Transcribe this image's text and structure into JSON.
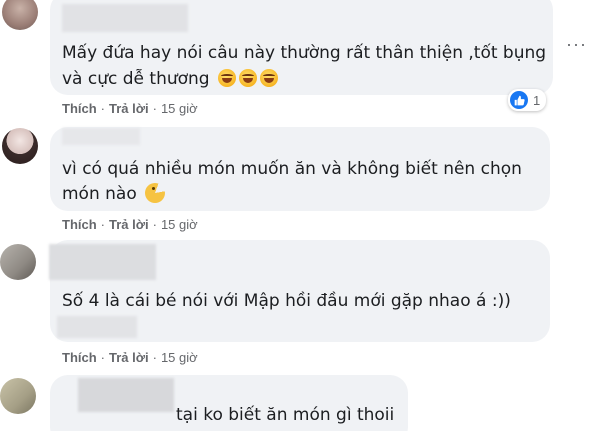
{
  "actions": {
    "like_label": "Thích",
    "reply_label": "Trả lời",
    "separator": "·"
  },
  "comments": [
    {
      "text_lines": [
        "Mấy đứa hay nói câu này thường rất thân thiện ,tốt bụng",
        "và cực dễ thương"
      ],
      "emoji": [
        "laughing-tears-icon",
        "laughing-tears-icon",
        "laughing-tears-icon"
      ],
      "time": "15 giờ",
      "reactions": {
        "icon": "like-icon",
        "count": "1"
      },
      "more": "···"
    },
    {
      "text_lines": [
        "vì có quá nhiều món muốn ăn và không biết nên chọn",
        "món nào"
      ],
      "emoji": [
        "pacman-icon"
      ],
      "time": "15 giờ"
    },
    {
      "text_lines": [
        "Số 4 là cái bé nói với Mập hồi đầu mới gặp nhao á :))"
      ],
      "time": "15 giờ"
    },
    {
      "text_lines": [
        "tại ko biết ăn món gì thoii"
      ]
    }
  ]
}
